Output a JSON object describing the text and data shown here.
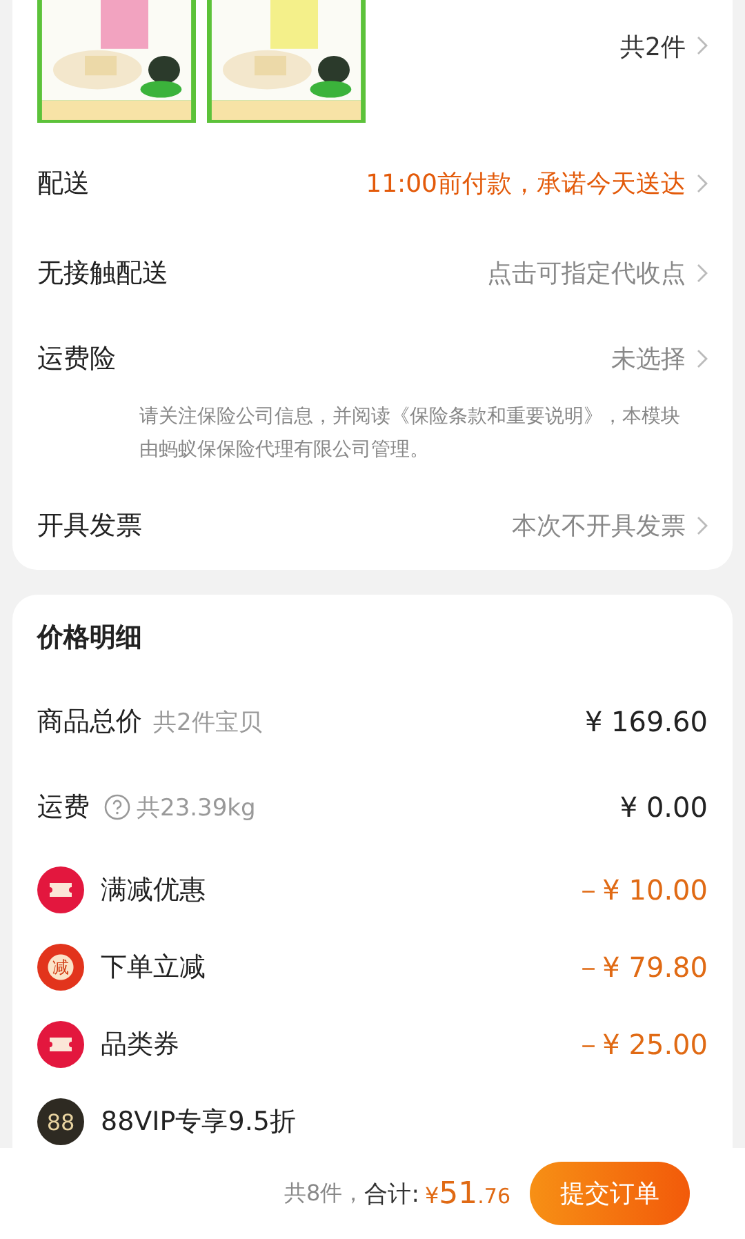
{
  "order": {
    "count": "共2件",
    "rows": [
      {
        "label": "配送",
        "value": "11:00前付款，承诺今天送达",
        "highlight": true
      },
      {
        "label": "无接触配送",
        "value": "点击可指定代收点",
        "highlight": false
      },
      {
        "label": "运费险",
        "value": "未选择",
        "highlight": false,
        "note": "请关注保险公司信息，并阅读《保险条款和重要说明》，本模块由蚂蚁保保险代理有限公司管理。"
      },
      {
        "label": "开具发票",
        "value": "本次不开具发票",
        "highlight": false
      }
    ]
  },
  "price": {
    "title": "价格明细",
    "rows": [
      {
        "kind": "plain",
        "label": "商品总价",
        "sub": "共2件宝贝",
        "value": "¥ 169.60"
      },
      {
        "kind": "shipping",
        "label": "运费",
        "sub": "共23.39kg",
        "value": "¥ 0.00"
      },
      {
        "kind": "coupon",
        "label": "满减优惠",
        "value": "－¥ 10.00"
      },
      {
        "kind": "instant",
        "icon_text": "减",
        "label": "下单立减",
        "value": "－¥ 79.80"
      },
      {
        "kind": "coupon",
        "label": "品类券",
        "value": "－¥ 25.00"
      },
      {
        "kind": "vip",
        "icon_text": "88",
        "label": "88VIP专享9.5折"
      }
    ]
  },
  "footer": {
    "count": "共8件，",
    "total_label": "合计:",
    "currency": "¥",
    "integer": "51",
    "decimal": ".76",
    "button": "提交订单"
  }
}
